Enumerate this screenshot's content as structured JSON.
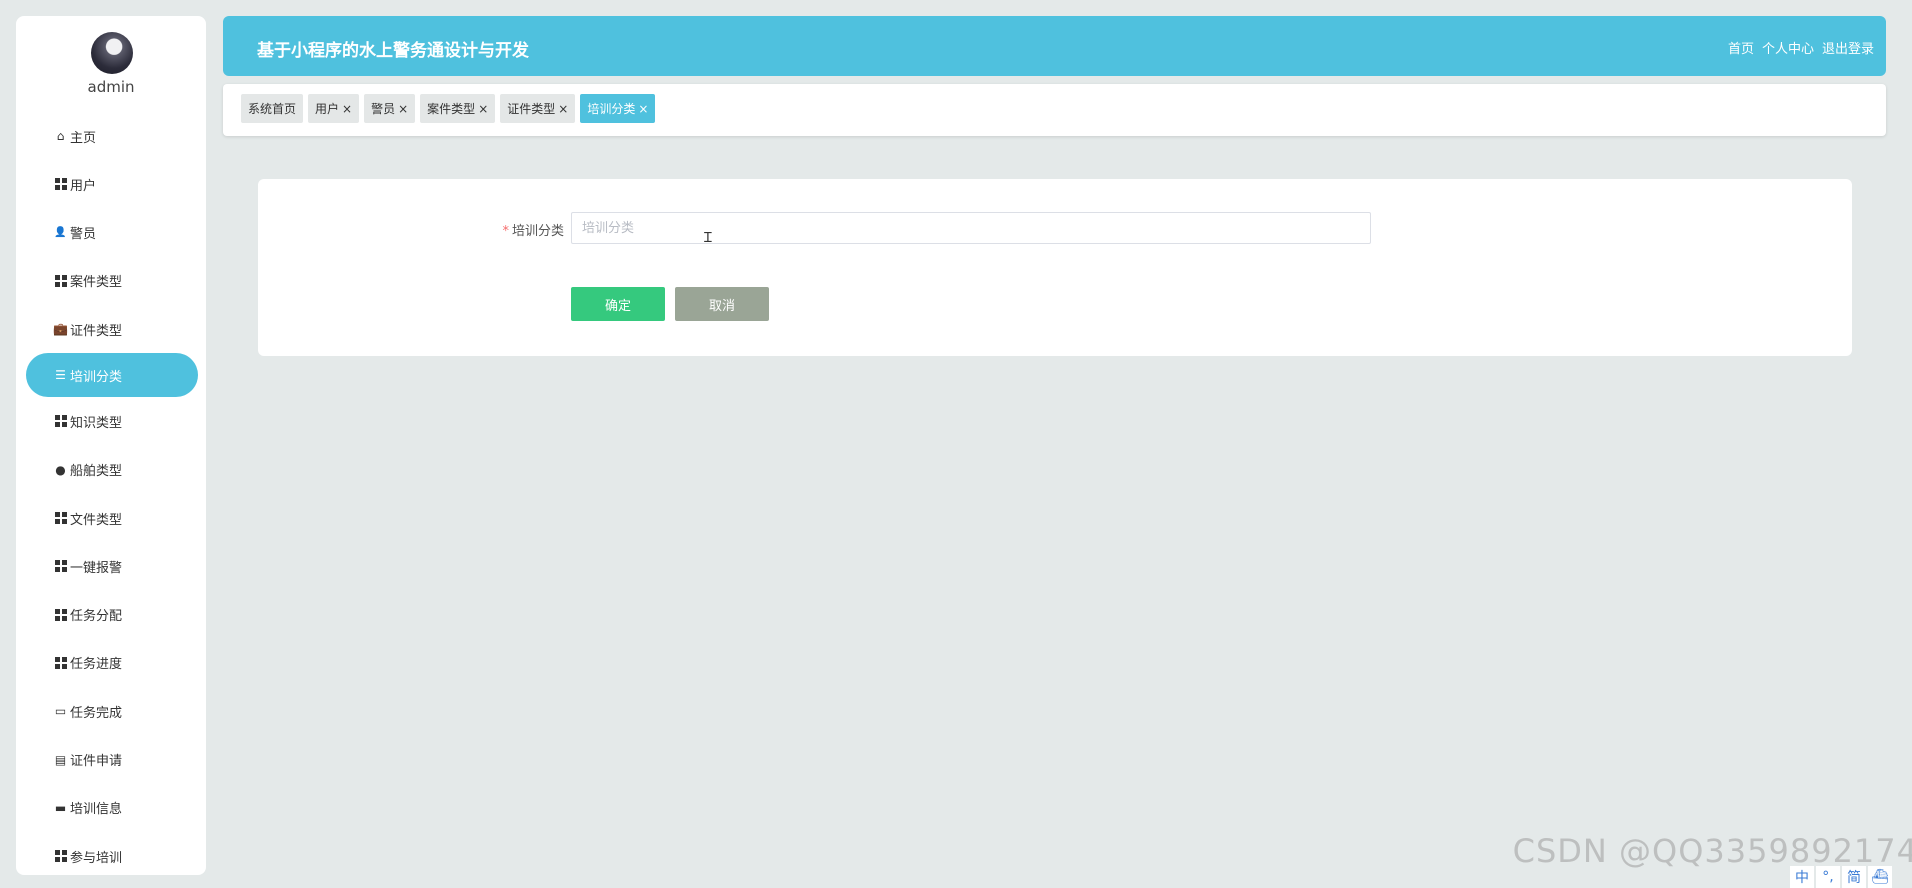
{
  "app": {
    "title": "基于小程序的水上警务通设计与开发",
    "username": "admin"
  },
  "header": {
    "links": [
      "首页",
      "个人中心",
      "退出登录"
    ]
  },
  "sidebar": {
    "items": [
      {
        "label": "主页",
        "icon": "home-icon"
      },
      {
        "label": "用户",
        "icon": "grid-icon"
      },
      {
        "label": "警员",
        "icon": "person-icon"
      },
      {
        "label": "案件类型",
        "icon": "grid-icon"
      },
      {
        "label": "证件类型",
        "icon": "briefcase-icon"
      },
      {
        "label": "培训分类",
        "icon": "sliders-icon",
        "active": true
      },
      {
        "label": "知识类型",
        "icon": "grid-icon"
      },
      {
        "label": "船舶类型",
        "icon": "location-pin-icon"
      },
      {
        "label": "文件类型",
        "icon": "grid-icon"
      },
      {
        "label": "一键报警",
        "icon": "grid-icon"
      },
      {
        "label": "任务分配",
        "icon": "grid-icon"
      },
      {
        "label": "任务进度",
        "icon": "grid-icon"
      },
      {
        "label": "任务完成",
        "icon": "printer-icon"
      },
      {
        "label": "证件申请",
        "icon": "clipboard-icon"
      },
      {
        "label": "培训信息",
        "icon": "bag-icon"
      },
      {
        "label": "参与培训",
        "icon": "grid-icon"
      }
    ]
  },
  "tags": [
    {
      "label": "系统首页",
      "closable": false
    },
    {
      "label": "用户",
      "closable": true
    },
    {
      "label": "警员",
      "closable": true
    },
    {
      "label": "案件类型",
      "closable": true
    },
    {
      "label": "证件类型",
      "closable": true
    },
    {
      "label": "培训分类",
      "closable": true,
      "active": true
    }
  ],
  "tag_close_glyph": "×",
  "form": {
    "required_mark": "*",
    "field_label": "培训分类",
    "field_value": "",
    "field_placeholder": "培训分类",
    "confirm_label": "确定",
    "cancel_label": "取消"
  },
  "watermark": "CSDN @QQ3359892174",
  "ime": [
    "中",
    "°,",
    "简",
    "⛴"
  ],
  "colors": {
    "accent": "#4fc1de",
    "confirm": "#35c97e",
    "cancel": "#9aa596",
    "background": "#e4e9e9"
  }
}
